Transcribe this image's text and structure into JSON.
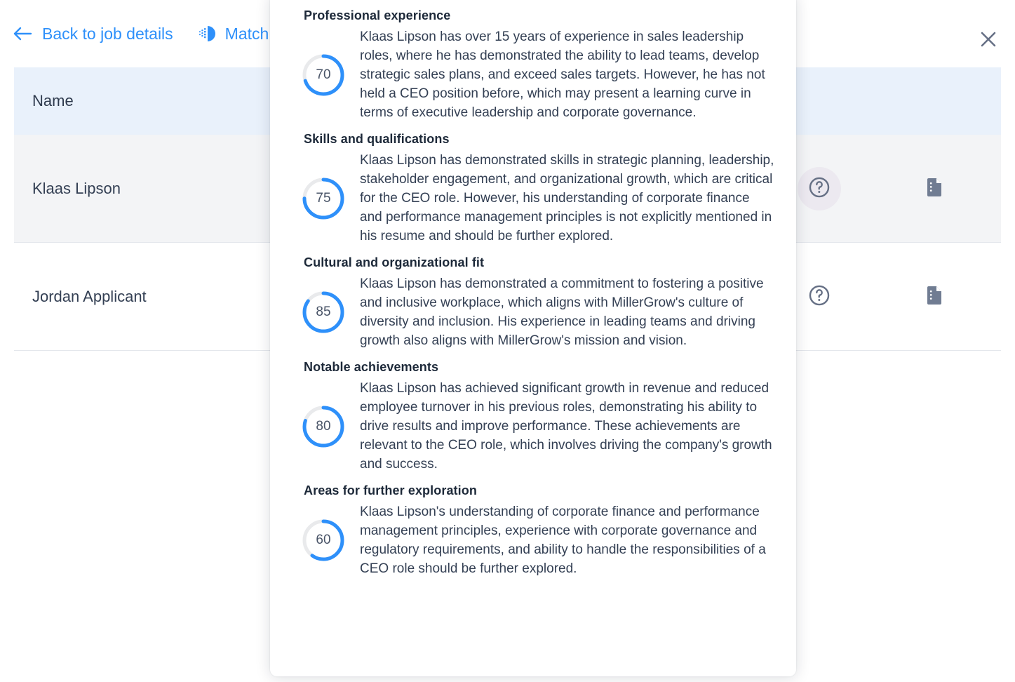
{
  "topbar": {
    "back_label": "Back to job details",
    "back_icon": "arrow-left-icon",
    "match_label": "Match",
    "match_icon": "match-score-icon",
    "close_icon": "close-icon"
  },
  "table": {
    "columns": [
      "Name"
    ],
    "rows": [
      {
        "name": "Klaas Lipson",
        "help_icon": "help-circle-icon",
        "doc_icon": "document-icon",
        "highlighted": true
      },
      {
        "name": "Jordan Applicant",
        "help_icon": "help-circle-icon",
        "doc_icon": "document-icon",
        "highlighted": false
      }
    ]
  },
  "modal": {
    "accent_color": "#2e90fa",
    "track_color": "#e9eaec",
    "sections": [
      {
        "title": "Professional experience",
        "score": 70,
        "text": "Klaas Lipson has over 15 years of experience in sales leadership roles, where he has demonstrated the ability to lead teams, develop strategic sales plans, and exceed sales targets. However, he has not held a CEO position before, which may present a learning curve in terms of executive leadership and corporate governance."
      },
      {
        "title": "Skills and qualifications",
        "score": 75,
        "text": "Klaas Lipson has demonstrated skills in strategic planning, leadership, stakeholder engagement, and organizational growth, which are critical for the CEO role. However, his understanding of corporate finance and performance management principles is not explicitly mentioned in his resume and should be further explored."
      },
      {
        "title": "Cultural and organizational fit",
        "score": 85,
        "text": "Klaas Lipson has demonstrated a commitment to fostering a positive and inclusive workplace, which aligns with MillerGrow's culture of diversity and inclusion. His experience in leading teams and driving growth also aligns with MillerGrow's mission and vision."
      },
      {
        "title": "Notable achievements",
        "score": 80,
        "text": "Klaas Lipson has achieved significant growth in revenue and reduced employee turnover in his previous roles, demonstrating his ability to drive results and improve performance. These achievements are relevant to the CEO role, which involves driving the company's growth and success."
      },
      {
        "title": "Areas for further exploration",
        "score": 60,
        "text": "Klaas Lipson's understanding of corporate finance and performance management principles, experience with corporate governance and regulatory requirements, and ability to handle the responsibilities of a CEO role should be further explored."
      }
    ]
  }
}
